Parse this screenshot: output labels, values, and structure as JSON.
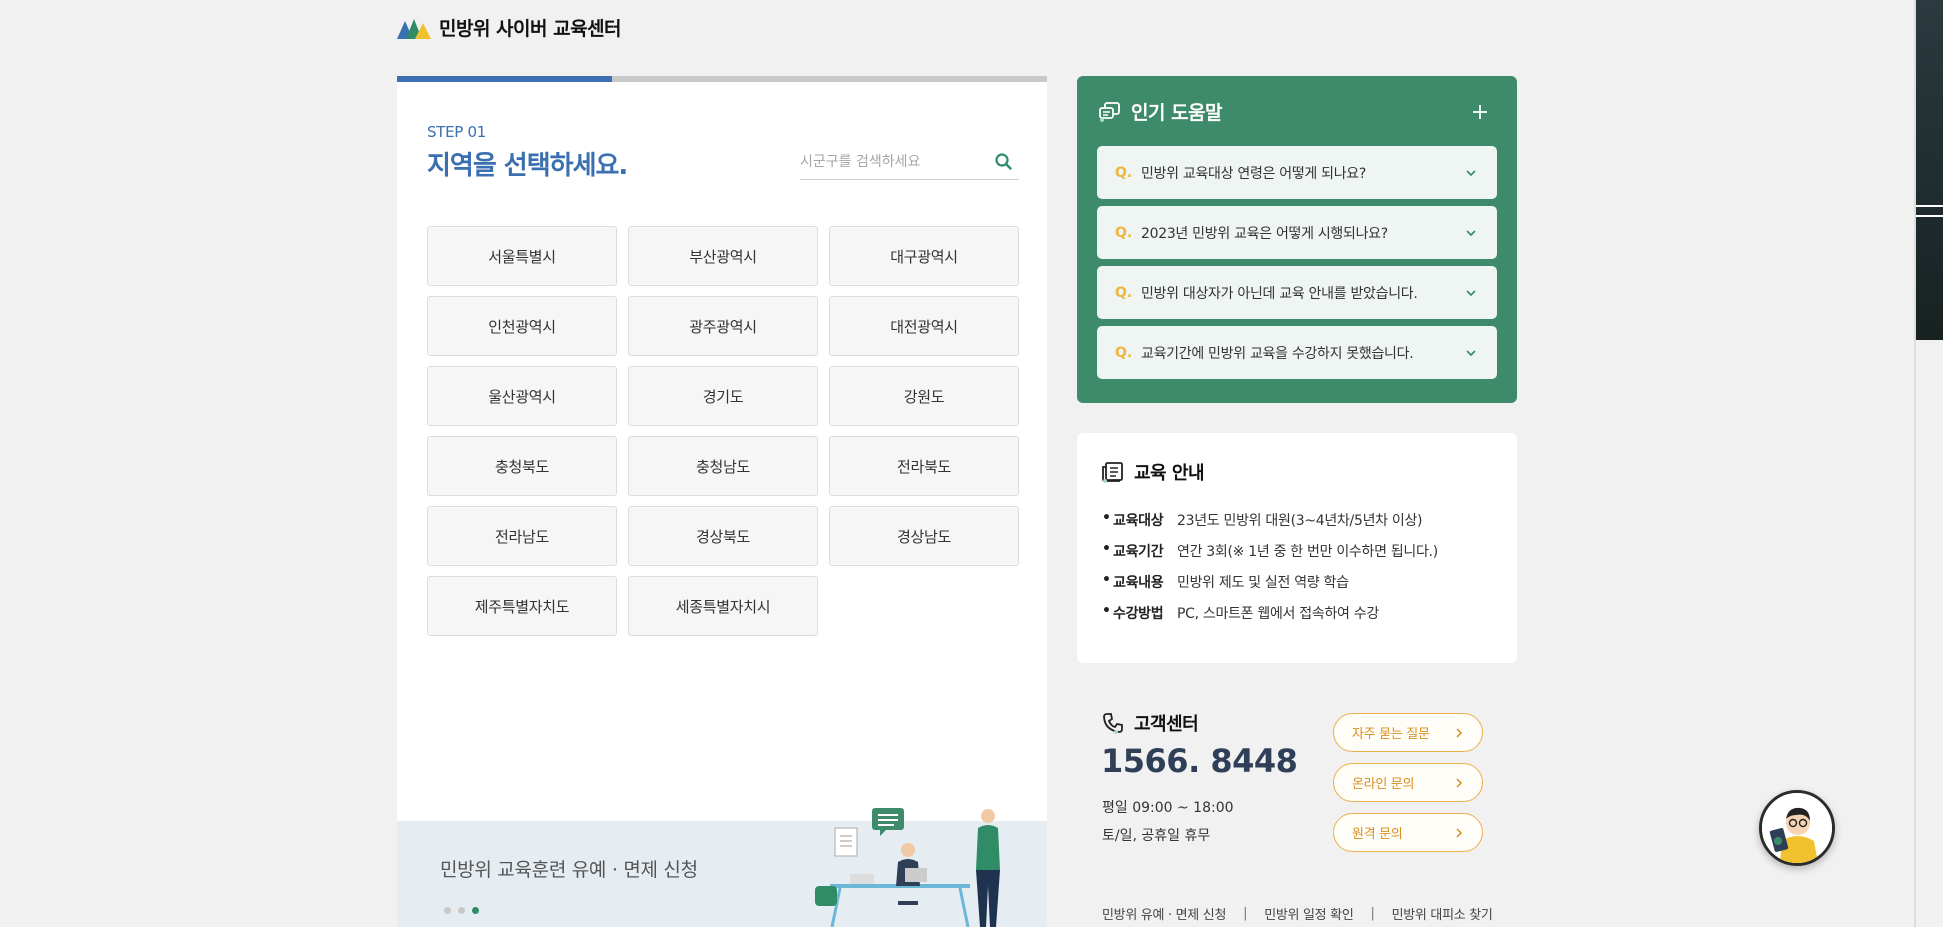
{
  "header": {
    "logo_text": "민방위 사이버 교육센터",
    "logo_colors": [
      "#3a6fb0",
      "#2f8c67",
      "#f2c12e"
    ]
  },
  "step": {
    "label": "STEP 01",
    "title": "지역을 선택하세요.",
    "progress_fraction": 0.33
  },
  "search": {
    "placeholder": "시군구를 검색하세요",
    "value": "",
    "icon": "search-icon"
  },
  "regions": [
    "서울특별시",
    "부산광역시",
    "대구광역시",
    "인천광역시",
    "광주광역시",
    "대전광역시",
    "울산광역시",
    "경기도",
    "강원도",
    "충청북도",
    "충청남도",
    "전라북도",
    "전라남도",
    "경상북도",
    "경상남도",
    "제주특별자치도",
    "세종특별자치시"
  ],
  "banner": {
    "text": "민방위 교육훈련 유예 · 면제 신청",
    "slide_count": 3,
    "active_slide": 3
  },
  "faq": {
    "title": "인기 도움말",
    "q_marker": "Q.",
    "items": [
      "민방위 교육대상 연령은 어떻게 되나요?",
      "2023년 민방위 교육은 어떻게 시행되나요?",
      "민방위 대상자가 아닌데 교육 안내를 받았습니다.",
      "교육기간에 민방위 교육을 수강하지 못했습니다."
    ]
  },
  "education": {
    "title": "교육 안내",
    "rows": [
      {
        "key": "교육대상",
        "value": "23년도 민방위 대원(3~4년차/5년차 이상)"
      },
      {
        "key": "교육기간",
        "value": "연간 3회(※ 1년 중 한 번만 이수하면 됩니다.)"
      },
      {
        "key": "교육내용",
        "value": "민방위 제도 및 실전 역량 학습"
      },
      {
        "key": "수강방법",
        "value": "PC, 스마트폰 웹에서 접속하여 수강"
      }
    ]
  },
  "customer_center": {
    "title": "고객센터",
    "phone": "1566. 8448",
    "hours_weekday": "평일 09:00 ~ 18:00",
    "hours_weekend": "토/일, 공휴일 휴무",
    "buttons": [
      "자주 묻는 질문",
      "온라인 문의",
      "원격 문의"
    ]
  },
  "footer_links": [
    "민방위 유예 · 면제 신청",
    "민방위 일정 확인",
    "민방위 대피소 찾기"
  ],
  "colors": {
    "primary_blue": "#3a6fb0",
    "green": "#3d8b6b",
    "orange": "#eab04c",
    "phone_navy": "#2f3f58"
  }
}
